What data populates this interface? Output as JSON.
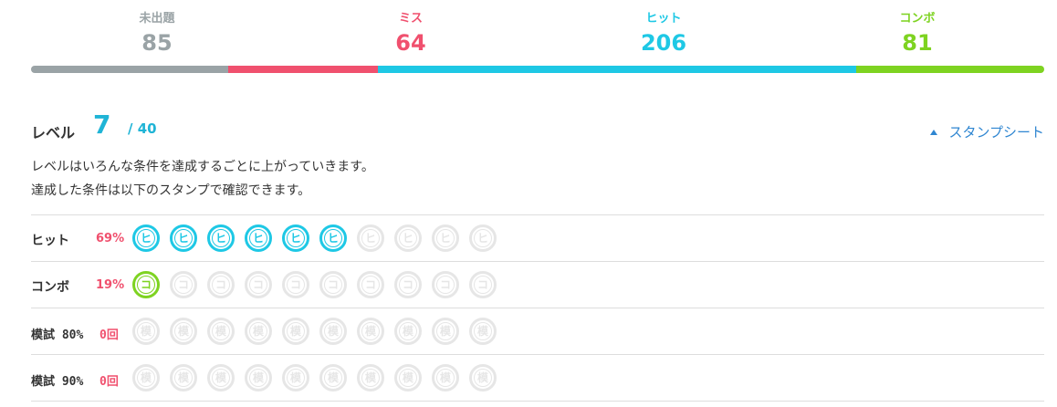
{
  "stats": [
    {
      "label": "未出題",
      "value": "85",
      "color": "#9aa3a6"
    },
    {
      "label": "ミス",
      "value": "64",
      "color": "#f0506e"
    },
    {
      "label": "ヒット",
      "value": "206",
      "color": "#1ec8e5"
    },
    {
      "label": "コンボ",
      "value": "81",
      "color": "#7ed321"
    }
  ],
  "progress": [
    {
      "name": "unanswered",
      "fraction": 0.195,
      "color": "#9aa3a6"
    },
    {
      "name": "miss",
      "fraction": 0.147,
      "color": "#f0506e"
    },
    {
      "name": "hit",
      "fraction": 0.472,
      "color": "#1ec8e5"
    },
    {
      "name": "combo",
      "fraction": 0.186,
      "color": "#7ed321"
    }
  ],
  "level": {
    "title": "レベル",
    "current": "7",
    "max": "/ 40"
  },
  "stamp_sheet_link": "スタンプシート",
  "description": [
    "レベルはいろんな条件を達成するごとに上がっていきます。",
    "達成した条件は以下のスタンプで確認できます。"
  ],
  "rows": [
    {
      "name": "ヒット",
      "stat": "69%",
      "glyph": "ヒ",
      "achieved": 6,
      "total": 10,
      "color": "#1ec8e5"
    },
    {
      "name": "コンボ",
      "stat": "19%",
      "glyph": "コ",
      "achieved": 1,
      "total": 10,
      "color": "#7ed321"
    },
    {
      "name": "模試 80%",
      "stat": "0回",
      "glyph": "模",
      "achieved": 0,
      "total": 10,
      "color": "#e6e6e6"
    },
    {
      "name": "模試 90%",
      "stat": "0回",
      "glyph": "模",
      "achieved": 0,
      "total": 10,
      "color": "#e6e6e6"
    }
  ]
}
